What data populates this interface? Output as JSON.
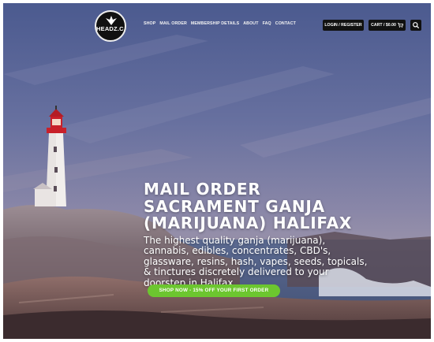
{
  "logo": {
    "text": "HEADZ.CA"
  },
  "nav": {
    "items": [
      {
        "label": "SHOP"
      },
      {
        "label": "MAIL ORDER"
      },
      {
        "label": "MEMBERSHIP DETAILS"
      },
      {
        "label": "ABOUT"
      },
      {
        "label": "FAQ"
      },
      {
        "label": "CONTACT"
      }
    ],
    "login_label": "LOGIN / REGISTER",
    "cart_label": "CART / $0.00",
    "cart_icon": "cart-icon",
    "search_icon": "search-icon"
  },
  "hero": {
    "title": "MAIL ORDER SACRAMENT GANJA (MARIJUANA) HALIFAX",
    "subtitle": "The highest quality ganja (marijuana), cannabis, edibles, concentrates, CBD's, glassware, resins, hash, vapes, seeds, topicals, & tinctures discretely delivered to your doorstep in Halifax",
    "cta_label": "SHOP NOW - 15% OFF YOUR FIRST ORDER"
  },
  "colors": {
    "accent": "#6cc62f",
    "button_dark": "#111111",
    "sky_top": "#4f5f93",
    "sky_mid": "#7c7fa6",
    "lighthouse_top": "#c8202a"
  }
}
